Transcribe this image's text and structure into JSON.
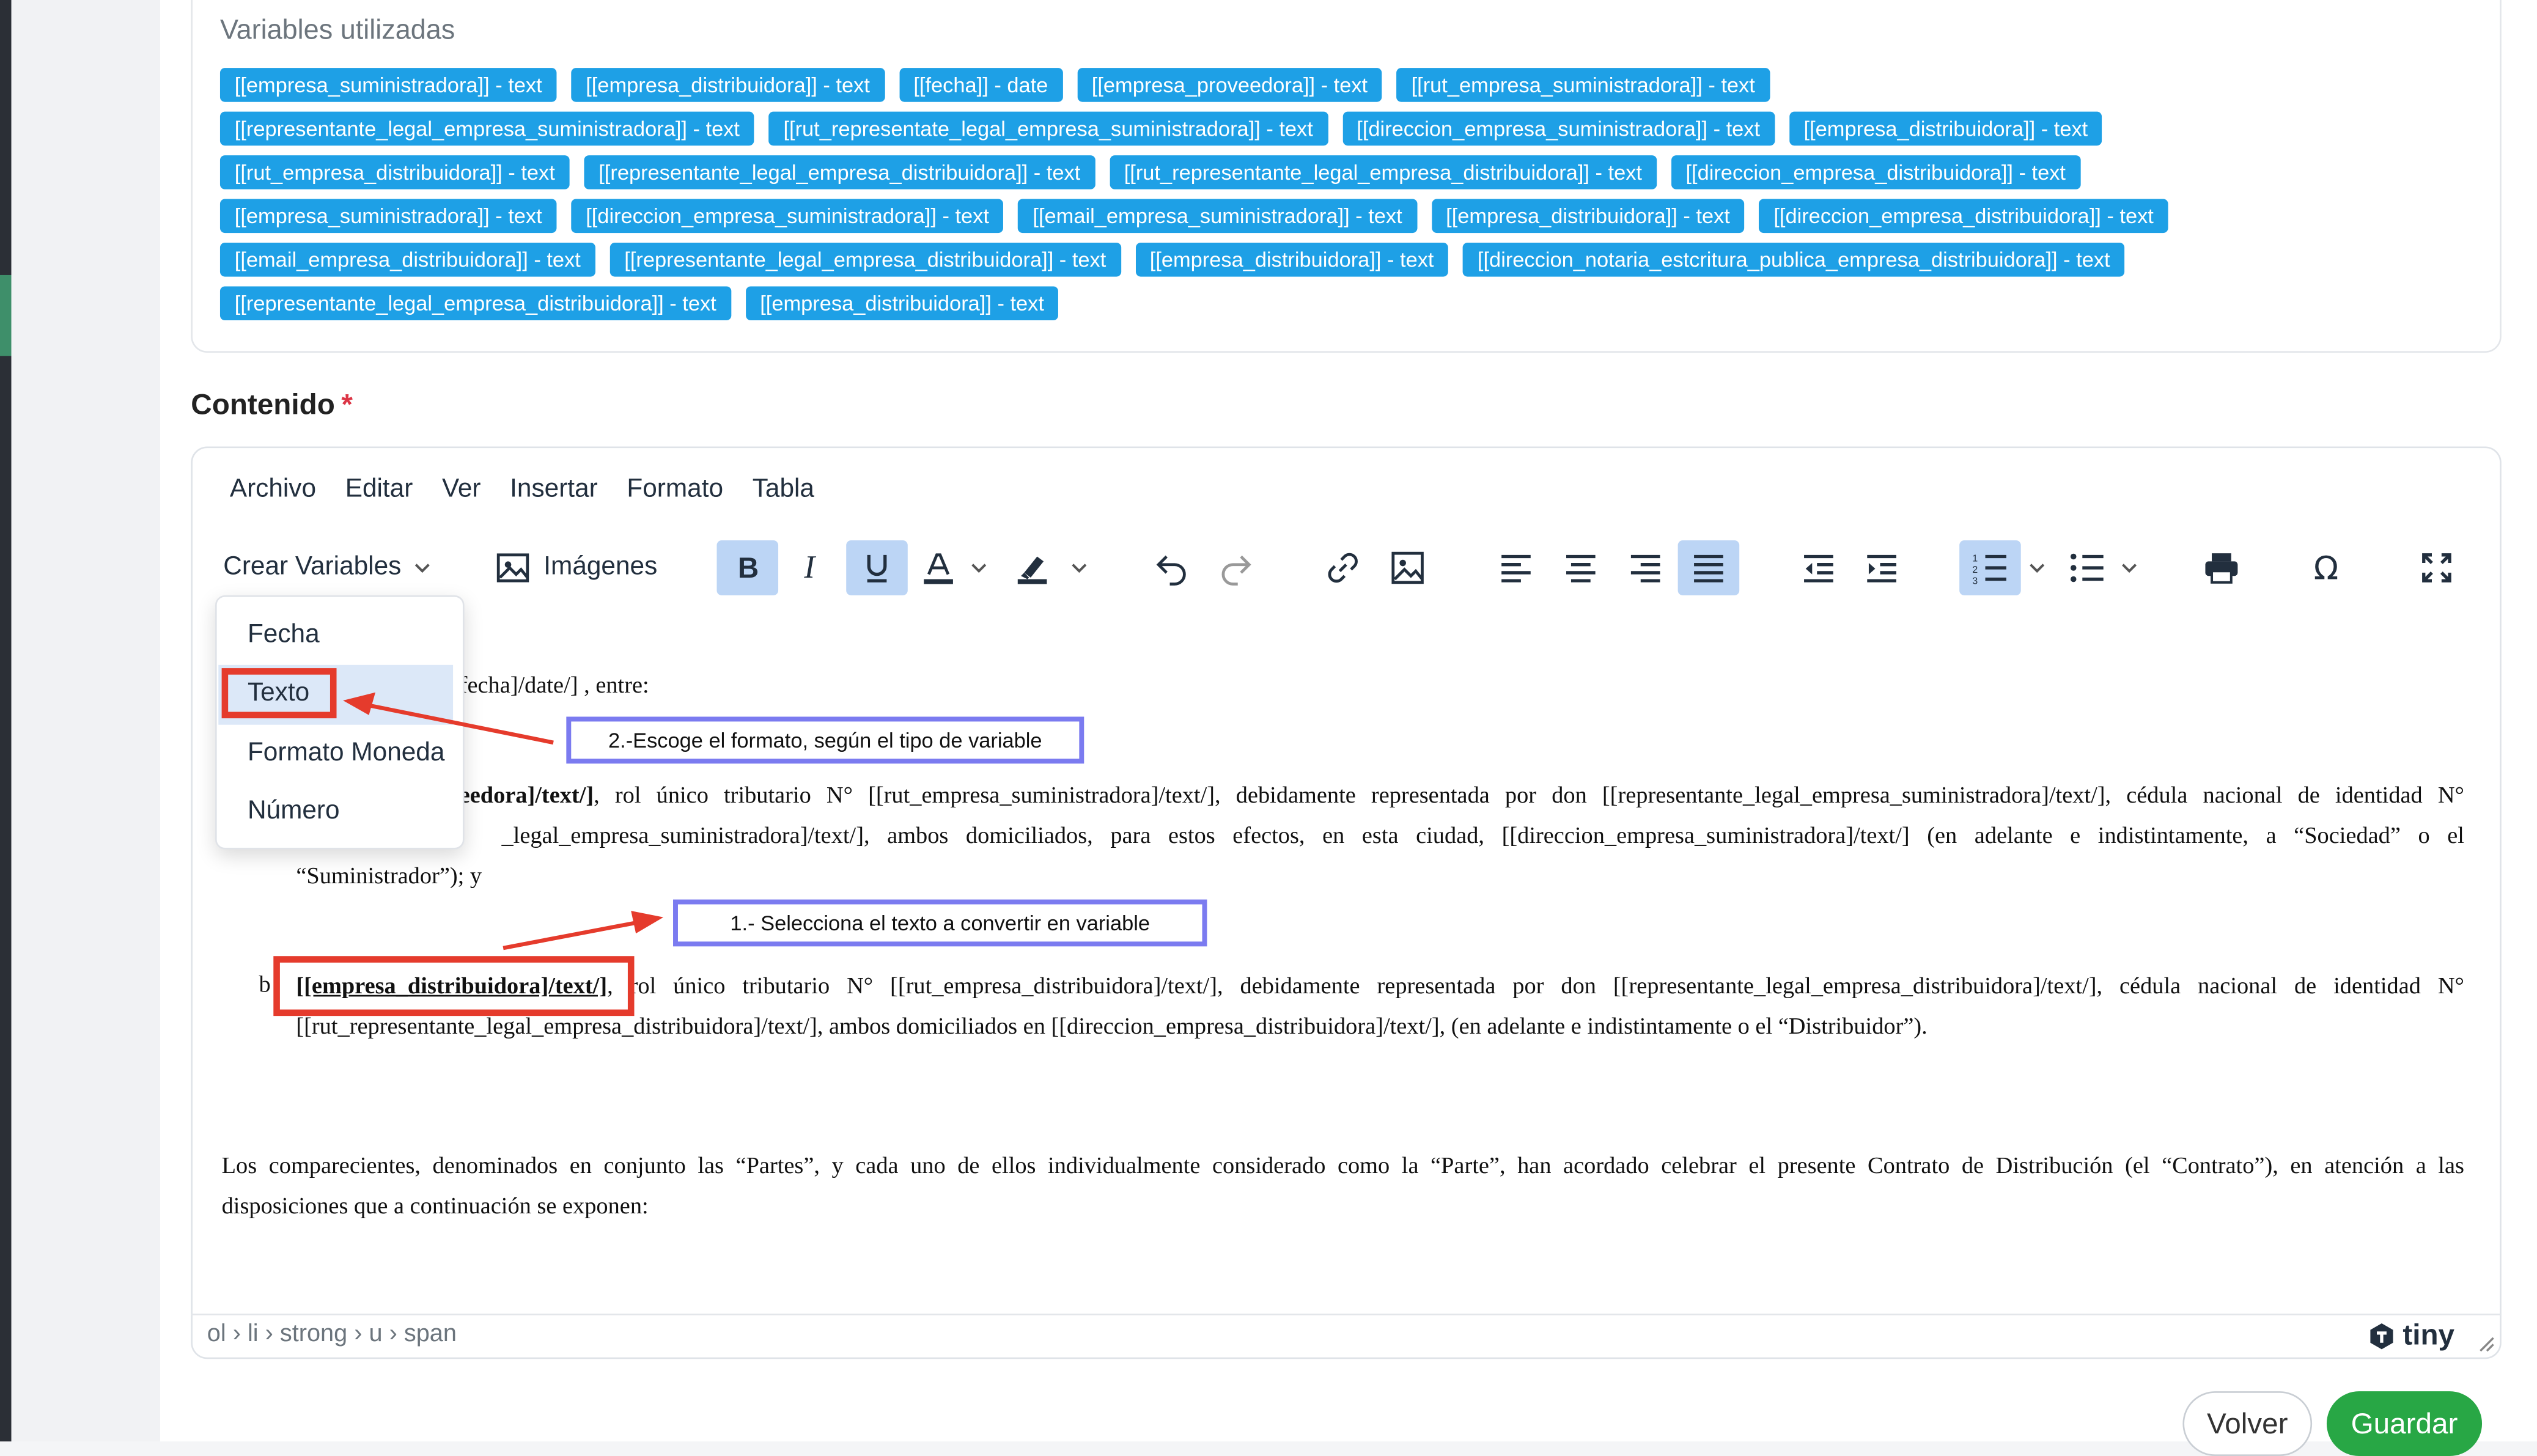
{
  "variables_card": {
    "title": "Variables utilizadas",
    "rows": [
      [
        "[[empresa_suministradora]] - text",
        "[[empresa_distribuidora]] - text",
        "[[fecha]] - date",
        "[[empresa_proveedora]] - text",
        "[[rut_empresa_suministradora]] - text"
      ],
      [
        "[[representante_legal_empresa_suministradora]] - text",
        "[[rut_representate_legal_empresa_suministradora]] - text",
        "[[direccion_empresa_suministradora]] - text",
        "[[empresa_distribuidora]] - text"
      ],
      [
        "[[rut_empresa_distribuidora]] - text",
        "[[representante_legal_empresa_distribuidora]] - text",
        "[[rut_representante_legal_empresa_distribuidora]] - text",
        "[[direccion_empresa_distribuidora]] - text"
      ],
      [
        "[[empresa_suministradora]] - text",
        "[[direccion_empresa_suministradora]] - text",
        "[[email_empresa_suministradora]] - text",
        "[[empresa_distribuidora]] - text",
        "[[direccion_empresa_distribuidora]] - text"
      ],
      [
        "[[email_empresa_distribuidora]] - text",
        "[[representante_legal_empresa_distribuidora]] - text",
        "[[empresa_distribuidora]] - text",
        "[[direccion_notaria_estcritura_publica_empresa_distribuidora]] - text"
      ],
      [
        "[[representante_legal_empresa_distribuidora]] - text",
        "[[empresa_distribuidora]] - text"
      ]
    ],
    "badge_color": "#1ea0e6"
  },
  "content_label": "Contenido",
  "required_mark": "*",
  "menubar": [
    "Archivo",
    "Editar",
    "Ver",
    "Insertar",
    "Formato",
    "Tabla"
  ],
  "toolbar": {
    "crear_variables": "Crear Variables",
    "imagenes": "Imágenes",
    "icons": [
      "bold-icon",
      "italic-icon",
      "underline-icon",
      "text-color-icon",
      "highlight-icon",
      "undo-icon",
      "redo-icon",
      "link-icon",
      "image-icon",
      "align-left-icon",
      "align-center-icon",
      "align-right-icon",
      "justify-icon",
      "outdent-icon",
      "indent-icon",
      "numbered-list-icon",
      "bullet-list-icon",
      "print-icon",
      "special-char-icon",
      "fullscreen-icon"
    ]
  },
  "dropdown": {
    "items": [
      "Fecha",
      "Texto",
      "Formato Moneda",
      "Número"
    ],
    "selected": "Texto"
  },
  "document": {
    "line1_tail": "fecha]/date/] , entre:",
    "a_line1_strong": "eedora]/text/]",
    "a_line1_rest": ", rol único tributario N° [[rut_empresa_suministradora]/text/], debidamente representada por don [[representante_legal_empresa_suministradora]/text/], cédula nacional de identidad N°",
    "a_line2_rest": "_legal_empresa_suministradora]/text/], ambos domiciliados, para estos efectos, en esta ciudad, [[direccion_empresa_suministradora]/text/] (en adelante e indistintamente, a “Sociedad” o el",
    "a_line3": "“Suministrador”); y",
    "b_marker": "b",
    "b_strong": "[[empresa_distribuidora]/text/]",
    "b_line1_rest": ", rol único tributario N° [[rut_empresa_distribuidora]/text/], debidamente representada por don [[representante_legal_empresa_distribuidora]/text/], cédula nacional de identidad N°",
    "b_line2": "[[rut_representante_legal_empresa_distribuidora]/text/], ambos domiciliados en [[direccion_empresa_distribuidora]/text/], (en adelante e indistintamente o el “Distribuidor”).",
    "para_line1": "Los comparecientes, denominados en conjunto las “Partes”, y cada uno de ellos individualmente considerado como la “Parte”, han acordado celebrar el presente Contrato de Distribución (el “Contrato”), en atención a las",
    "para_line2": "disposiciones que a continuación se exponen:"
  },
  "annotations": {
    "step1": "1.- Selecciona el texto a convertir en variable",
    "step2": "2.-Escoge el formato, según el tipo de variable"
  },
  "statusbar": {
    "path": "ol › li › strong › u › span",
    "brand": "tiny"
  },
  "buttons": {
    "volver": "Volver",
    "guardar": "Guardar"
  }
}
